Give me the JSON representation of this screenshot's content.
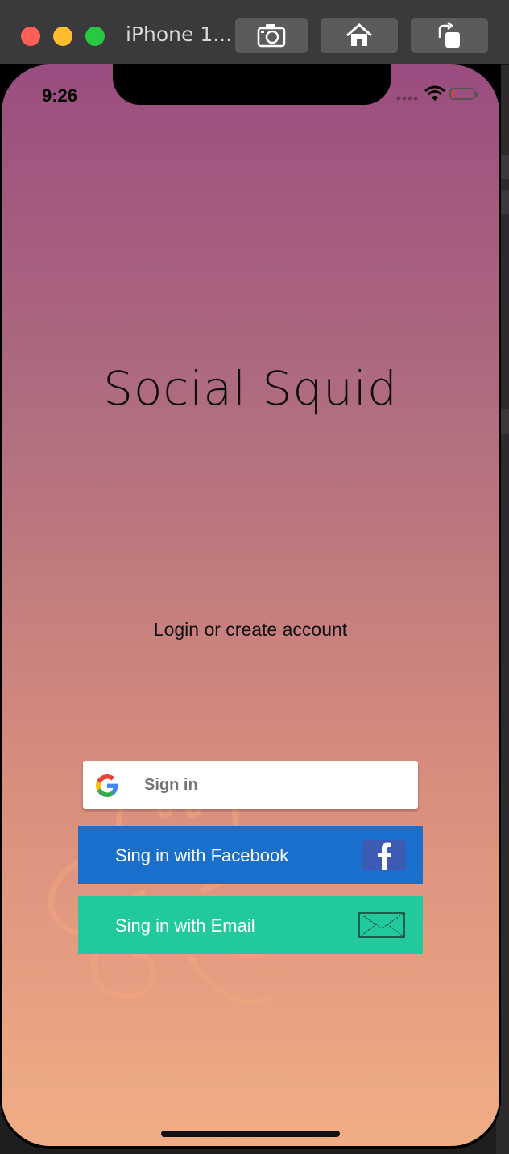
{
  "window": {
    "title": "iPhone 1..."
  },
  "status_bar": {
    "time": "9:26"
  },
  "app": {
    "title": "Social Squid",
    "subtitle": "Login or create account",
    "google_button_label": "Sign in",
    "facebook_button_label": "Sing in with Facebook",
    "email_button_label": "Sing in with Email"
  },
  "colors": {
    "facebook": "#1a6fcc",
    "email": "#21c99c",
    "gradient_top": "#9a4d7f",
    "gradient_bottom": "#f1ad85"
  },
  "icons": {
    "screenshot": "camera-icon",
    "home": "home-icon",
    "rotate": "rotate-icon",
    "google": "google-g-icon",
    "facebook": "facebook-f-icon",
    "email": "envelope-icon"
  }
}
